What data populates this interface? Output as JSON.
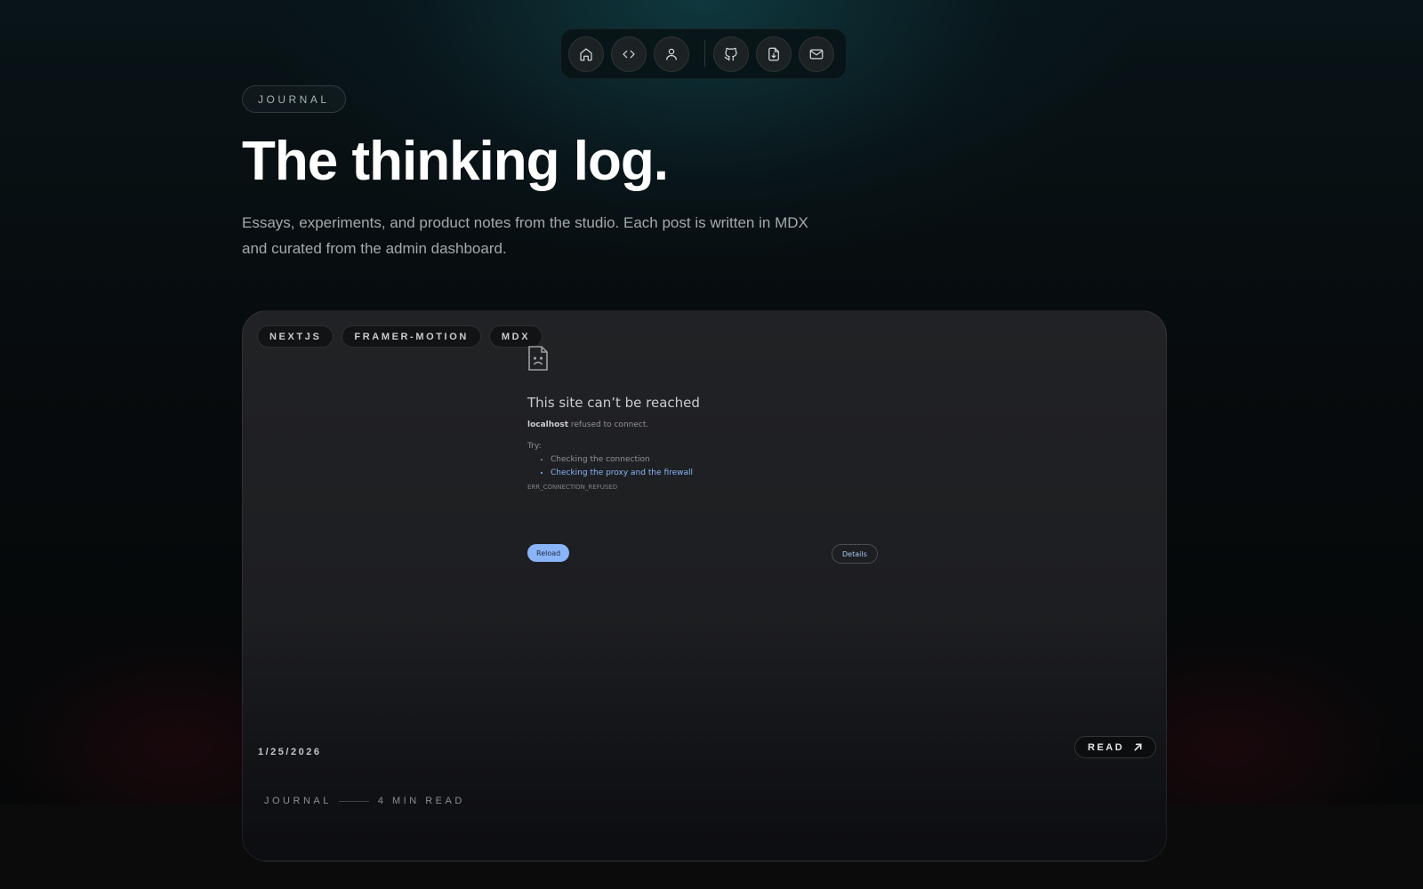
{
  "nav": {
    "items": [
      {
        "icon": "home-icon",
        "label": "Home"
      },
      {
        "icon": "code-icon",
        "label": "Code"
      },
      {
        "icon": "user-icon",
        "label": "About"
      },
      {
        "icon": "github-icon",
        "label": "GitHub"
      },
      {
        "icon": "download-file-icon",
        "label": "Resume"
      },
      {
        "icon": "mail-icon",
        "label": "Contact"
      }
    ]
  },
  "header": {
    "eyebrow": "JOURNAL",
    "title": "The thinking log.",
    "subtitle": "Essays, experiments, and product notes from the studio. Each post is written in MDX and curated from the admin dashboard."
  },
  "post": {
    "tags": [
      "NEXTJS",
      "FRAMER-MOTION",
      "MDX"
    ],
    "date": "1/25/2026",
    "read_label": "READ",
    "category": "JOURNAL",
    "read_time": "4 MIN READ",
    "cover_error": {
      "title": "This site can’t be reached",
      "host": "localhost",
      "message": " refused to connect.",
      "try_label": "Try:",
      "suggestions": [
        "Checking the connection",
        "Checking the proxy and the firewall"
      ],
      "code": "ERR_CONNECTION_REFUSED",
      "reload_label": "Reload",
      "details_label": "Details"
    }
  },
  "colors": {
    "background": "#060708",
    "card": "#212225",
    "link": "#8ab4f8"
  }
}
